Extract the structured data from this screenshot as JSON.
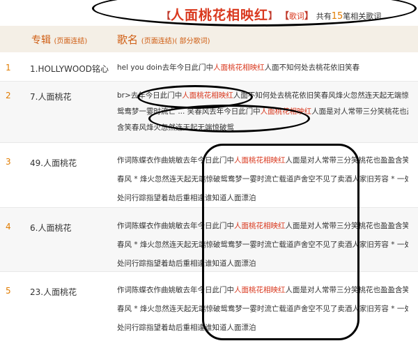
{
  "header": {
    "lbracket": "【",
    "keyword": "人面桃花相映红",
    "rbracket": "】",
    "tag_lb": "【",
    "tag": "歌词",
    "tag_rb": "】",
    "pre_count": "共有",
    "count": "15",
    "post_count": "笔相关歌词"
  },
  "columns": {
    "album": "专辑",
    "album_note": "(页面连结)",
    "song": "歌名",
    "song_note": "(页面连结)( 部分歌词)"
  },
  "rows": [
    {
      "num": "1",
      "album": "1.HOLLYWOOD铭心",
      "lines": [
        [
          "hel you doin去年今日此门中",
          "人面桃花相映红",
          "人面不知何处去桃花依旧笑春"
        ]
      ]
    },
    {
      "num": "2",
      "album": "7.人面桃花",
      "lines": [
        [
          "br>去年今日此门中",
          "人面桃花相映红",
          "人面不知何处去桃花依旧笑春风烽火忽然连天起无端惊破"
        ],
        [
          "鸳鸯梦一霎时流亡 ... 笑春风去年今日此门中",
          "人面桃花相映红",
          "人面是对人常带三分笑桃花也盈盈"
        ],
        [
          "含笑春风烽火忽然连天起无端惊破鸳",
          "",
          ""
        ]
      ]
    },
    {
      "num": "3",
      "album": "49.人面桃花",
      "lines": [
        [
          "作词陈蝶衣作曲姚敏去年今日此门中",
          "人面桃花相映红",
          "人面是对人常带三分笑桃花也盈盈含笑舞"
        ],
        [
          "春风 * 烽火忽然连天起无端惊破鸳鸯梦一霎时流亡载道庐舍空不见了卖酒人家旧芳容 * 一处一",
          "",
          ""
        ],
        [
          "处问行踪指望着劫后重相逢谁知道人面漂泊",
          "",
          ""
        ]
      ]
    },
    {
      "num": "4",
      "album": "6.人面桃花",
      "lines": [
        [
          "作词陈蝶衣作曲姚敏去年今日此门中",
          "人面桃花相映红",
          "人面是对人常带三分笑桃花也盈盈含笑舞"
        ],
        [
          "春风 * 烽火忽然连天起无端惊破鸳鸯梦一霎时流亡载道庐舍空不见了卖酒人家旧芳容 * 一处一",
          "",
          ""
        ],
        [
          "处问行踪指望着劫后重相逢谁知道人面漂泊",
          "",
          ""
        ]
      ]
    },
    {
      "num": "5",
      "album": "23.人面桃花",
      "lines": [
        [
          "作词陈蝶衣作曲姚敏去年今日此门中",
          "人面桃花相映红",
          "人面是对人常带三分笑桃花也盈盈含笑舞"
        ],
        [
          "春风 * 烽火忽然连天起无端惊破鸳鸯梦一霎时流亡载道庐舍空不见了卖酒人家旧芳容 * 一处一",
          "",
          ""
        ],
        [
          "处问行踪指望着劫后重相逢谁知道人面漂泊",
          "",
          ""
        ]
      ]
    }
  ],
  "colors": {
    "accent": "#cf5d12",
    "keyword": "#d9381e",
    "number": "#e07b00",
    "header_bg": "#f4efe6"
  }
}
